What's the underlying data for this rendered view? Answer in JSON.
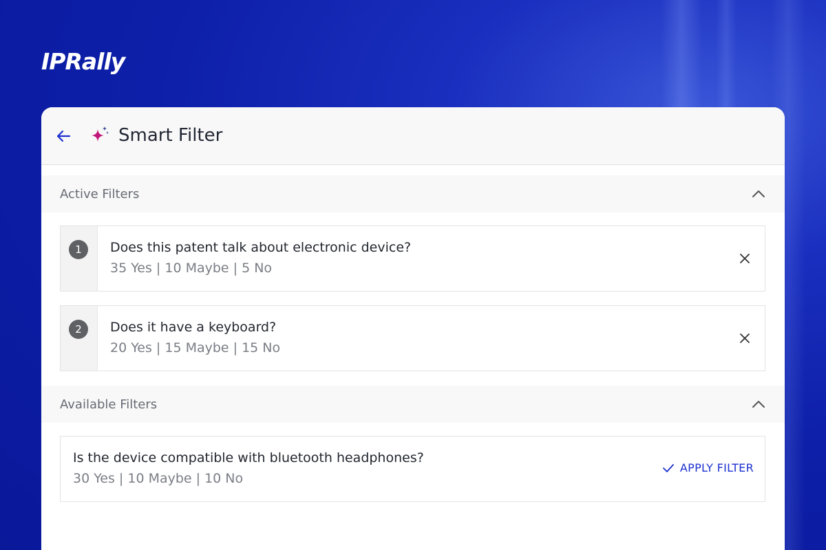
{
  "brand": {
    "logo_text": "IPRally"
  },
  "header": {
    "title": "Smart Filter",
    "back_icon": "arrow-left-icon",
    "title_icon": "sparkle-icon",
    "accent_color": "#1b2fd0",
    "sparkle_color": "#c2177a"
  },
  "active_filters": {
    "title": "Active Filters",
    "collapse_icon": "chevron-up-icon",
    "items": [
      {
        "number": "1",
        "question": "Does this patent talk about electronic device?",
        "counts": "35 Yes | 10 Maybe | 5 No",
        "remove_icon": "close-icon"
      },
      {
        "number": "2",
        "question": "Does it have a keyboard?",
        "counts": "20 Yes | 15 Maybe | 15 No",
        "remove_icon": "close-icon"
      }
    ]
  },
  "available_filters": {
    "title": "Available Filters",
    "collapse_icon": "chevron-up-icon",
    "items": [
      {
        "question": "Is the device compatible with bluetooth headphones?",
        "counts": "30 Yes | 10 Maybe | 10 No",
        "action_label": "APPLY FILTER",
        "action_icon": "check-icon"
      }
    ]
  }
}
